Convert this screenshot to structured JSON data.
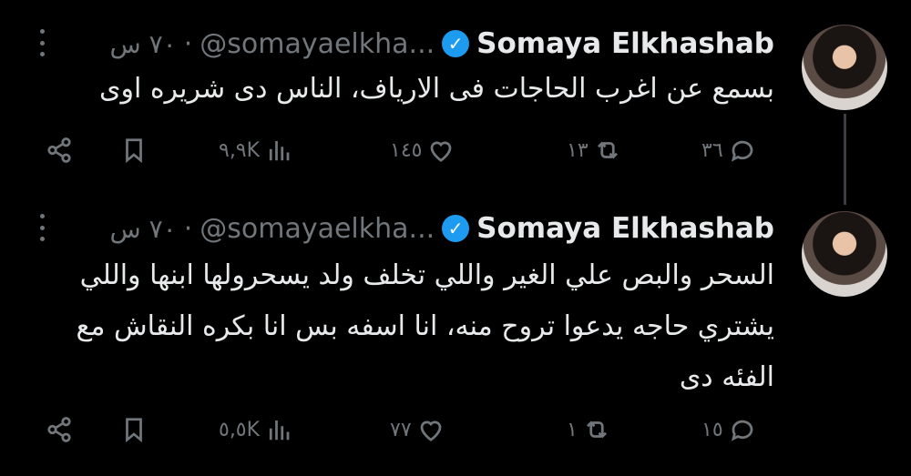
{
  "tweets": [
    {
      "author": "Somaya Elkhashab",
      "handle": "@somayaelkha...",
      "separator": "·",
      "time": "٧٠ س",
      "text": "بسمع عن اغرب الحاجات فى الارياف، الناس دى شريره اوى",
      "stats": {
        "views": "٩,٩K",
        "likes": "١٤٥",
        "retweets": "١٣",
        "replies": "٣٦"
      }
    },
    {
      "author": "Somaya Elkhashab",
      "handle": "@somayaelkha...",
      "separator": "·",
      "time": "٧٠ س",
      "text": "السحر والبص علي الغير واللي تخلف ولد يسحرولها ابنها واللي يشتري حاجه يدعوا تروح منه، انا اسفه بس انا بكره النقاش مع الفئه دى",
      "stats": {
        "views": "٥,٥K",
        "likes": "٧٧",
        "retweets": "١",
        "replies": "١٥"
      }
    }
  ],
  "icons": {
    "verified": "verified-badge-icon",
    "more": "more-vertical-icon",
    "share": "share-icon",
    "bookmark": "bookmark-icon",
    "views": "views-bar-chart-icon",
    "like": "heart-icon",
    "retweet": "retweet-icon",
    "reply": "reply-bubble-icon"
  },
  "colors": {
    "background": "#000000",
    "text": "#e7e9ea",
    "muted": "#71767b",
    "verified": "#1d9bf0"
  }
}
